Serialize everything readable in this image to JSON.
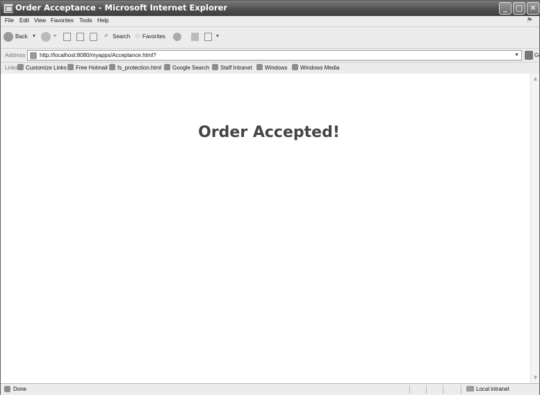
{
  "window": {
    "title": "Order Acceptance - Microsoft Internet Explorer",
    "minimize_glyph": "_",
    "maximize_glyph": "□",
    "close_glyph": "✕"
  },
  "menu": [
    "File",
    "Edit",
    "View",
    "Favorites",
    "Tools",
    "Help"
  ],
  "toolbar": {
    "back_label": "Back",
    "search_label": "Search",
    "favorites_label": "Favorites"
  },
  "address": {
    "label": "Address",
    "url": "http://localhost:8080/myapps/Acceptance.html?",
    "go_label": "Go"
  },
  "links": {
    "label": "Links",
    "items": [
      "Customize Links",
      "Free Hotmail",
      "fs_protection.html",
      "Google Search",
      "Staff Intranet",
      "Windows",
      "Windows Media"
    ]
  },
  "page": {
    "heading": "Order Accepted!"
  },
  "status": {
    "text": "Done",
    "zone": "Local intranet"
  }
}
